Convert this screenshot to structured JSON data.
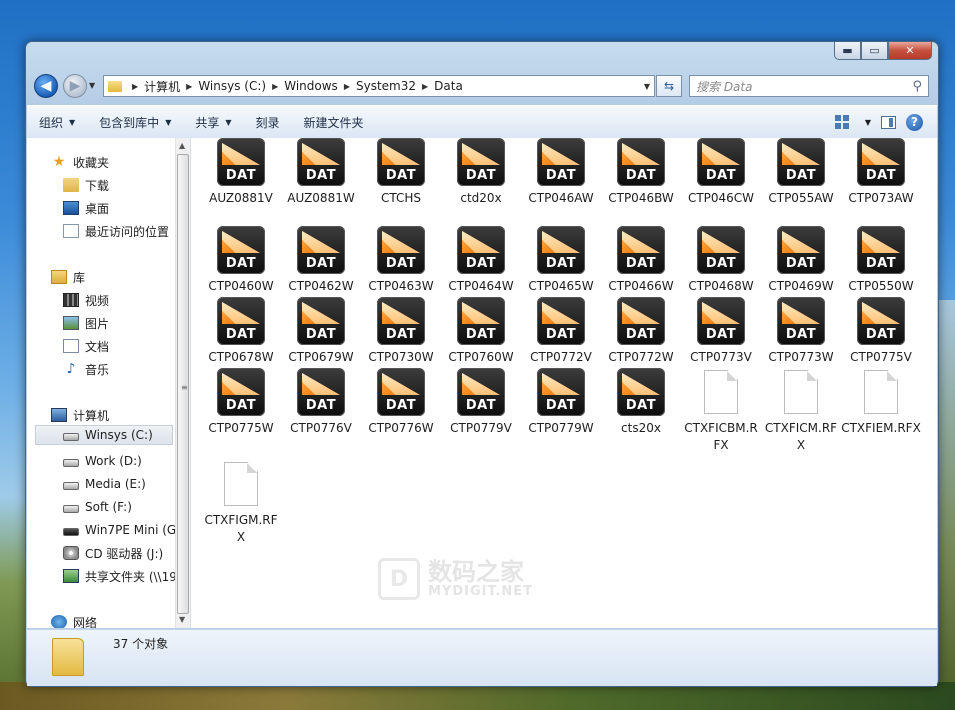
{
  "window": {
    "min": "▬",
    "max": "▭",
    "close": "✕"
  },
  "nav": {
    "back": "◀",
    "forward": "▶"
  },
  "address": {
    "crumbs": [
      "计算机",
      "Winsys (C:)",
      "Windows",
      "System32",
      "Data"
    ]
  },
  "search": {
    "placeholder": "搜索 Data"
  },
  "toolbar": {
    "organize": "组织",
    "include_library": "包含到库中",
    "share": "共享",
    "burn": "刻录",
    "new_folder": "新建文件夹"
  },
  "sidebar": {
    "favorites": "收藏夹",
    "downloads": "下载",
    "desktop": "桌面",
    "recent": "最近访问的位置",
    "libraries": "库",
    "videos": "视频",
    "pictures": "图片",
    "documents": "文档",
    "music": "音乐",
    "computer": "计算机",
    "drives": [
      "Winsys (C:)",
      "Work (D:)",
      "Media (E:)",
      "Soft (F:)",
      "Win7PE Mini (G"
    ],
    "cd": "CD 驱动器 (J:)",
    "share": "共享文件夹 (\\\\19",
    "network": "网络"
  },
  "files": [
    {
      "name": "AUZ0881V",
      "type": "DAT"
    },
    {
      "name": "AUZ0881W",
      "type": "DAT"
    },
    {
      "name": "CTCHS",
      "type": "DAT"
    },
    {
      "name": "ctd20x",
      "type": "DAT"
    },
    {
      "name": "CTP046AW",
      "type": "DAT"
    },
    {
      "name": "CTP046BW",
      "type": "DAT"
    },
    {
      "name": "CTP046CW",
      "type": "DAT"
    },
    {
      "name": "CTP055AW",
      "type": "DAT"
    },
    {
      "name": "CTP073AW",
      "type": "DAT"
    },
    {
      "name": "CTP0460W",
      "type": "DAT"
    },
    {
      "name": "CTP0462W",
      "type": "DAT"
    },
    {
      "name": "CTP0463W",
      "type": "DAT"
    },
    {
      "name": "CTP0464W",
      "type": "DAT"
    },
    {
      "name": "CTP0465W",
      "type": "DAT"
    },
    {
      "name": "CTP0466W",
      "type": "DAT"
    },
    {
      "name": "CTP0468W",
      "type": "DAT"
    },
    {
      "name": "CTP0469W",
      "type": "DAT"
    },
    {
      "name": "CTP0550W",
      "type": "DAT"
    },
    {
      "name": "CTP0678W",
      "type": "DAT"
    },
    {
      "name": "CTP0679W",
      "type": "DAT"
    },
    {
      "name": "CTP0730W",
      "type": "DAT"
    },
    {
      "name": "CTP0760W",
      "type": "DAT"
    },
    {
      "name": "CTP0772V",
      "type": "DAT"
    },
    {
      "name": "CTP0772W",
      "type": "DAT"
    },
    {
      "name": "CTP0773V",
      "type": "DAT"
    },
    {
      "name": "CTP0773W",
      "type": "DAT"
    },
    {
      "name": "CTP0775V",
      "type": "DAT"
    },
    {
      "name": "CTP0775W",
      "type": "DAT"
    },
    {
      "name": "CTP0776V",
      "type": "DAT"
    },
    {
      "name": "CTP0776W",
      "type": "DAT"
    },
    {
      "name": "CTP0779V",
      "type": "DAT"
    },
    {
      "name": "CTP0779W",
      "type": "DAT"
    },
    {
      "name": "cts20x",
      "type": "DAT"
    },
    {
      "name": "CTXFICBM.RFX",
      "type": "RFX"
    },
    {
      "name": "CTXFICM.RFX",
      "type": "RFX"
    },
    {
      "name": "CTXFIEM.RFX",
      "type": "RFX"
    },
    {
      "name": "CTXFIGM.RFX",
      "type": "RFX"
    }
  ],
  "dat_label": "DAT",
  "status": {
    "count": "37 个对象"
  },
  "watermark": {
    "cn": "数码之家",
    "en": "MYDIGIT.NET",
    "logo": "D"
  }
}
